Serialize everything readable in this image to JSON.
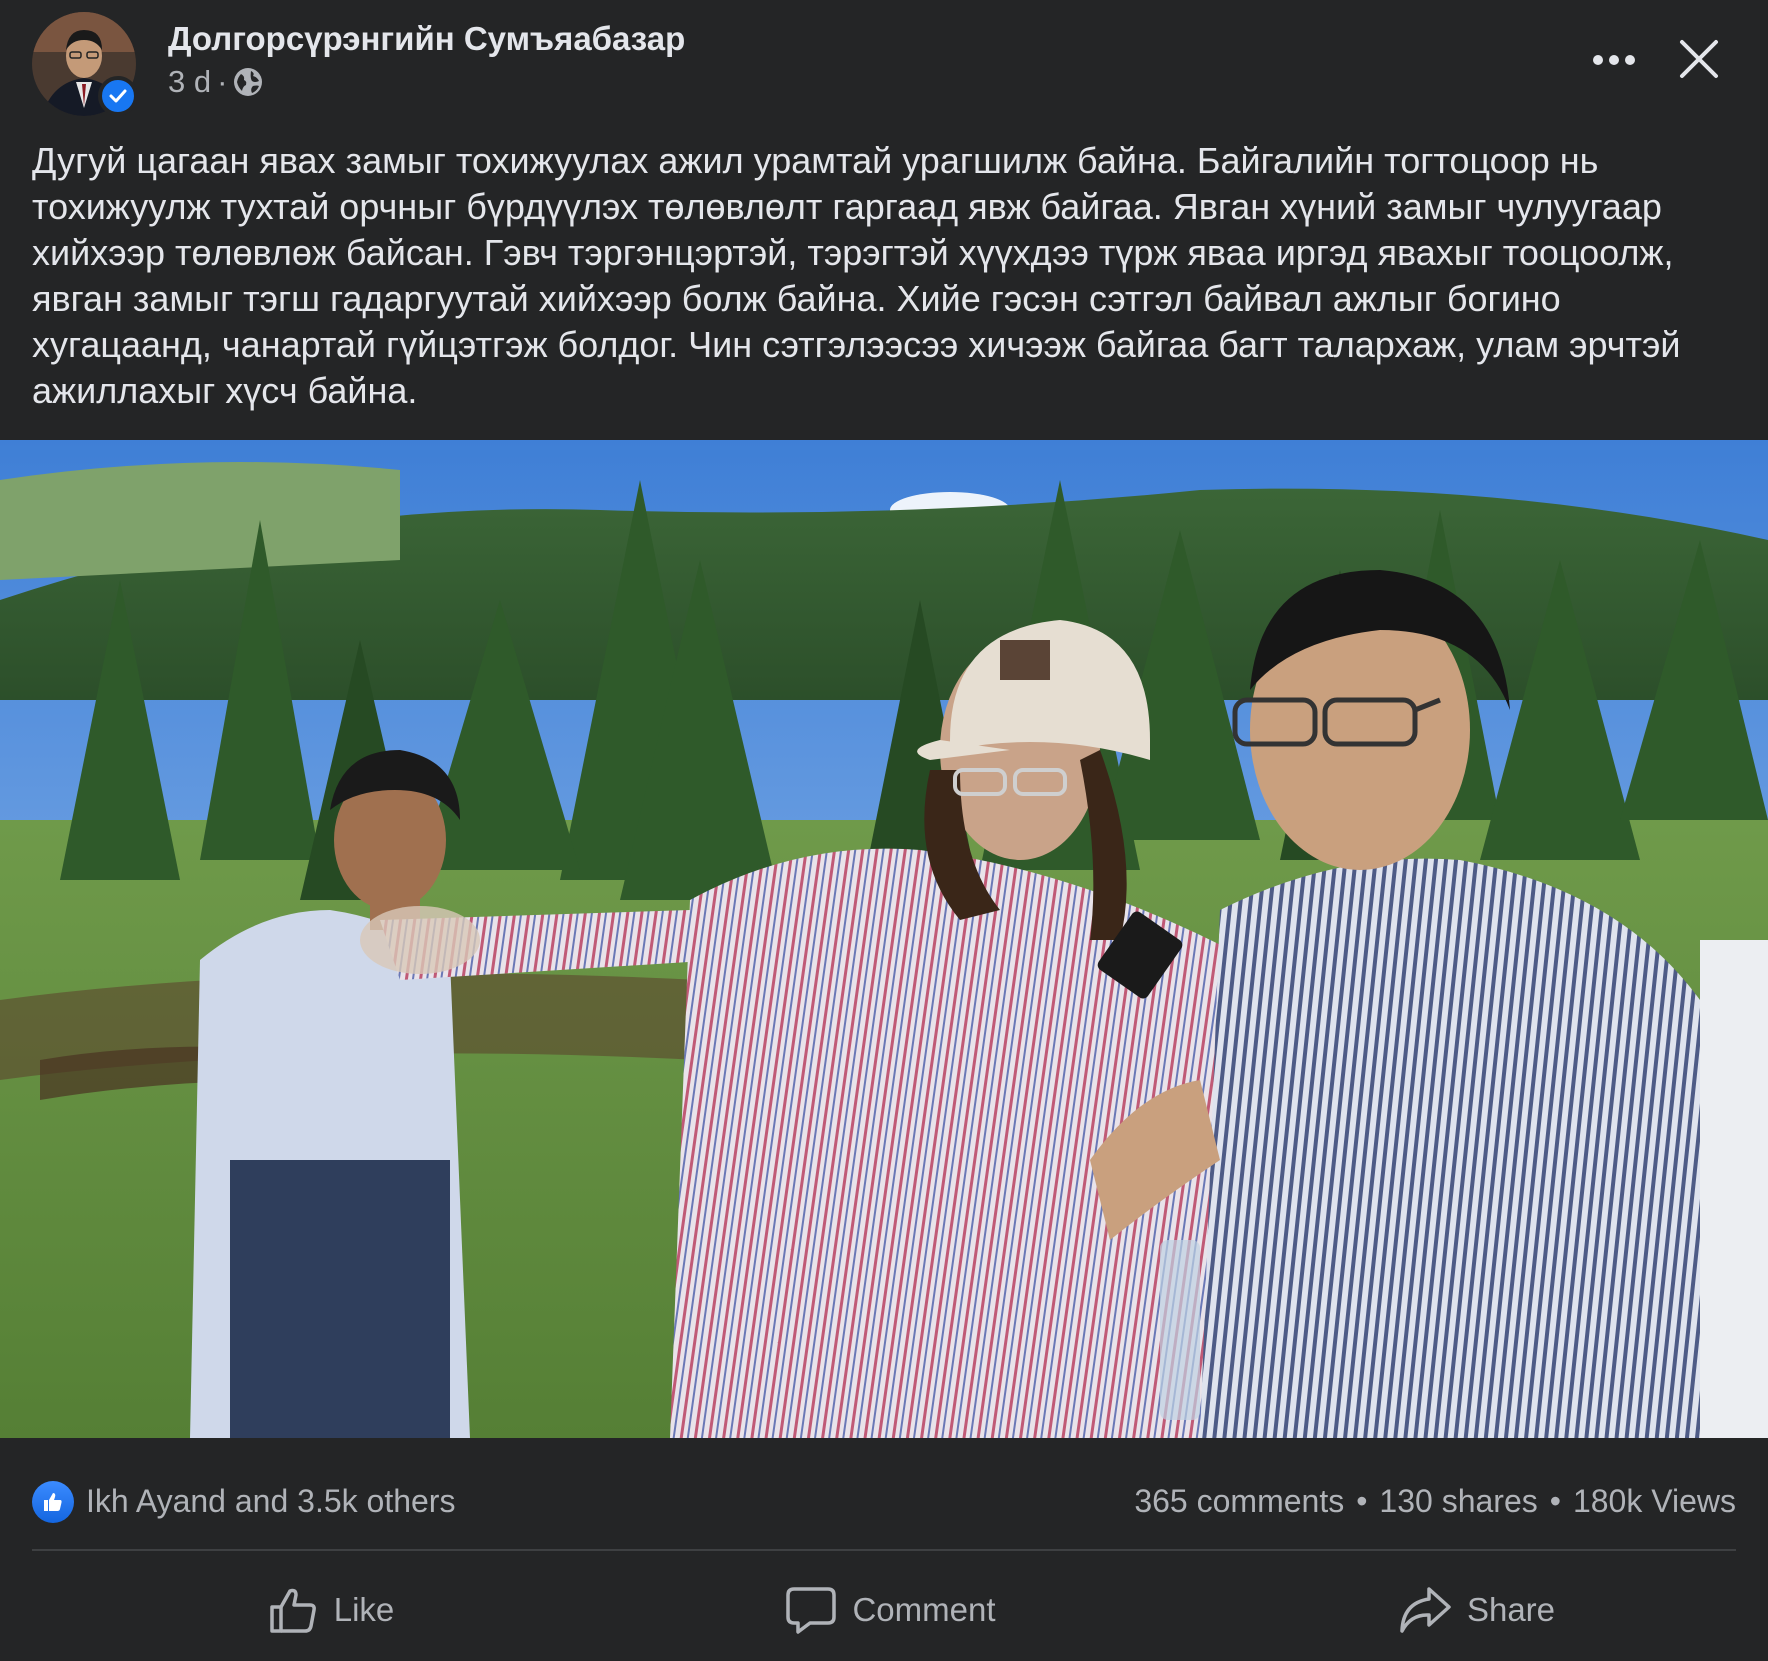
{
  "post": {
    "author": "Долгорсүрэнгийн Сумъяабазар",
    "time": "3 d",
    "separator": "·",
    "privacy_icon": "globe-icon",
    "verified_icon": "verified-check-icon",
    "text": "Дугуй цагаан явах замыг тохижуулах ажил урамтай урагшилж байна. Байгалийн тогтоцоор нь тохижуулж тухтай орчныг бүрдүүлэх төлөвлөлт гаргаад явж байгаа. Явган хүний замыг чулуугаар хийхээр төлөвлөж байсан. Гэвч тэргэнцэртэй, тэрэгтэй хүүхдээ түрж яваа иргэд явахыг тооцоолж, явган замыг тэгш гадаргуутай хийхээр болж байна. Хийе гэсэн сэтгэл байвал ажлыг богино хугацаанд, чанартай гүйцэтгэж болдог. Чин сэтгэлээсээ хичээж байгаа багт талархаж, улам эрчтэй ажиллахыг хүсч байна."
  },
  "reactions": {
    "text": "Ikh Ayand and 3.5k others",
    "icon": "like-reaction-icon"
  },
  "stats": {
    "comments": "365 comments",
    "shares": "130 shares",
    "views": "180k Views",
    "separator": "•"
  },
  "actions": {
    "like": "Like",
    "comment": "Comment",
    "share": "Share"
  },
  "colors": {
    "background": "#242526",
    "text_primary": "#e4e6eb",
    "text_secondary": "#b0b3b8",
    "accent": "#1877f2"
  }
}
